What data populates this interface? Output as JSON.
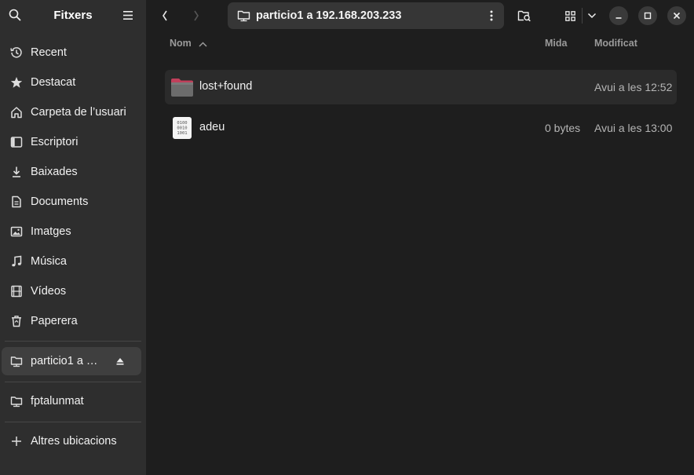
{
  "sidebar": {
    "title": "Fitxers",
    "items": [
      {
        "label": "Recent",
        "icon": "clock-icon"
      },
      {
        "label": "Destacat",
        "icon": "star-icon"
      },
      {
        "label": "Carpeta de l’usuari",
        "icon": "home-icon"
      },
      {
        "label": "Escriptori",
        "icon": "desktop-icon"
      },
      {
        "label": "Baixades",
        "icon": "download-icon"
      },
      {
        "label": "Documents",
        "icon": "document-icon"
      },
      {
        "label": "Imatges",
        "icon": "image-icon"
      },
      {
        "label": "Música",
        "icon": "music-icon"
      },
      {
        "label": "Vídeos",
        "icon": "video-icon"
      },
      {
        "label": "Paperera",
        "icon": "trash-icon"
      }
    ],
    "mount": {
      "label": "particio1 a …",
      "icon": "network-folder-icon",
      "eject_icon": "eject-icon"
    },
    "bookmark": {
      "label": "fptalunmat",
      "icon": "network-folder-icon"
    },
    "other_locations": {
      "label": "Altres ubicacions",
      "icon": "plus-icon"
    }
  },
  "toolbar": {
    "back_icon": "chevron-left-icon",
    "forward_icon": "chevron-right-icon",
    "path": "particio1 a 192.168.203.233",
    "path_icon": "network-folder-icon",
    "path_menu_icon": "vertical-dots-icon",
    "search_icon": "folder-search-icon",
    "view_icon": "grid-view-icon",
    "view_menu_icon": "chevron-down-icon"
  },
  "columns": {
    "name": "Nom",
    "size": "Mida",
    "modified": "Modificat"
  },
  "files": [
    {
      "name": "lost+found",
      "size": "",
      "modified": "Avui a les 12:52",
      "type": "folder"
    },
    {
      "name": "adeu",
      "size": "0 bytes",
      "modified": "Avui a les 13:00",
      "type": "binary-file"
    }
  ],
  "colors": {
    "sidebar_bg": "#2e2e2e",
    "main_bg": "#1e1e1e",
    "selected_bg": "#3f3f3f",
    "folder_accent": "#c0405b"
  }
}
